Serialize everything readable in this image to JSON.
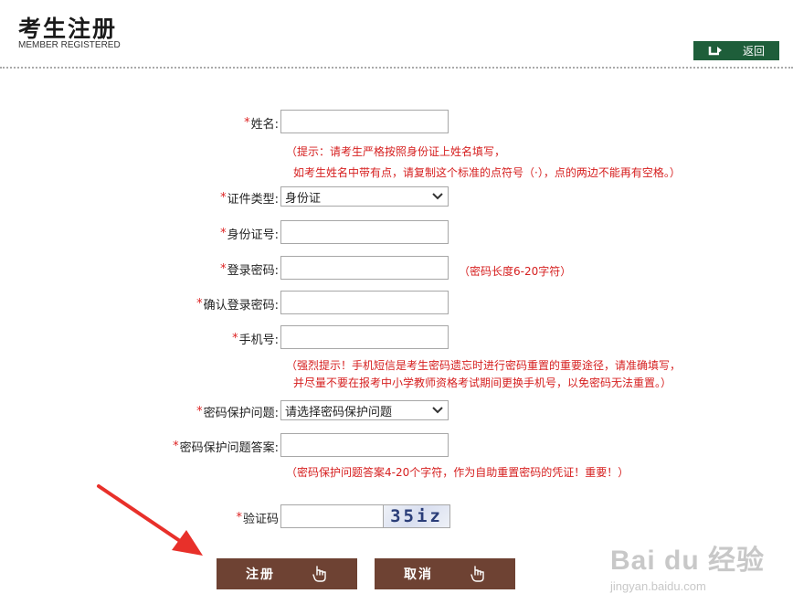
{
  "header": {
    "title_cn": "考生注册",
    "title_en": "MEMBER REGISTERED",
    "back_label": "返回"
  },
  "form": {
    "required_mark": "*",
    "name": {
      "label": "姓名:",
      "value": ""
    },
    "name_hint_1": "（提示：请考生严格按照身份证上姓名填写，",
    "name_hint_2": "如考生姓名中带有点，请复制这个标准的点符号（·），点的两边不能再有空格。）",
    "id_type": {
      "label": "证件类型:",
      "selected": "身份证"
    },
    "id_number": {
      "label": "身份证号:",
      "value": ""
    },
    "password": {
      "label": "登录密码:",
      "value": "",
      "hint": "（密码长度6-20字符）"
    },
    "confirm_password": {
      "label": "确认登录密码:",
      "value": ""
    },
    "phone": {
      "label": "手机号:",
      "value": ""
    },
    "phone_hint_1": "（强烈提示！手机短信是考生密码遗忘时进行密码重置的重要途径，请准确填写，",
    "phone_hint_2": "并尽量不要在报考中小学教师资格考试期间更换手机号，以免密码无法重置。）",
    "security_question": {
      "label": "密码保护问题:",
      "selected": "请选择密码保护问题"
    },
    "security_answer": {
      "label": "密码保护问题答案:",
      "value": ""
    },
    "answer_hint": "（密码保护问题答案4-20个字符，作为自助重置密码的凭证！重要！）",
    "captcha": {
      "label": "验证码",
      "value": "",
      "image_text": "35iz"
    }
  },
  "buttons": {
    "register": "注册",
    "cancel": "取消"
  },
  "watermark": {
    "main": "Bai du 经验",
    "sub": "jingyan.baidu.com"
  },
  "colors": {
    "back_button": "#1e5e3a",
    "action_button": "#6e4233",
    "hint_text": "#d62020",
    "arrow": "#e8302a"
  }
}
